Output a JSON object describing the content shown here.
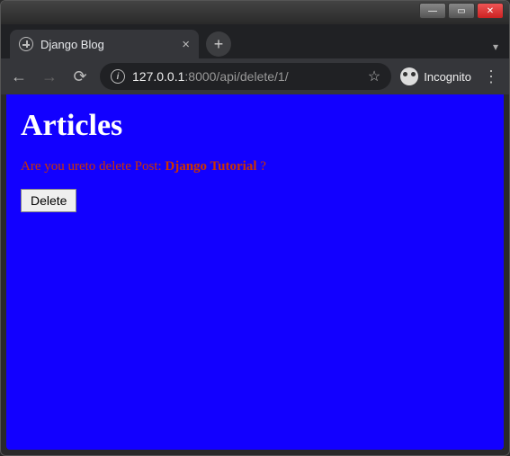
{
  "window": {
    "minimize": "—",
    "maximize": "▭",
    "close": "✕"
  },
  "tab": {
    "title": "Django Blog",
    "close": "×"
  },
  "newtab": "+",
  "tabdropdown": "▾",
  "nav": {
    "back": "←",
    "forward": "→",
    "reload": "⟳"
  },
  "url": {
    "info": "i",
    "host": "127.0.0.1",
    "path": ":8000/api/delete/1/"
  },
  "star": "☆",
  "incognito": {
    "label": "Incognito"
  },
  "kebab": "⋮",
  "page": {
    "heading": "Articles",
    "line_prefix": "Are you ureto delete Post: ",
    "post_title": "Django Tutorial",
    "line_suffix": " ?",
    "delete_label": "Delete"
  }
}
